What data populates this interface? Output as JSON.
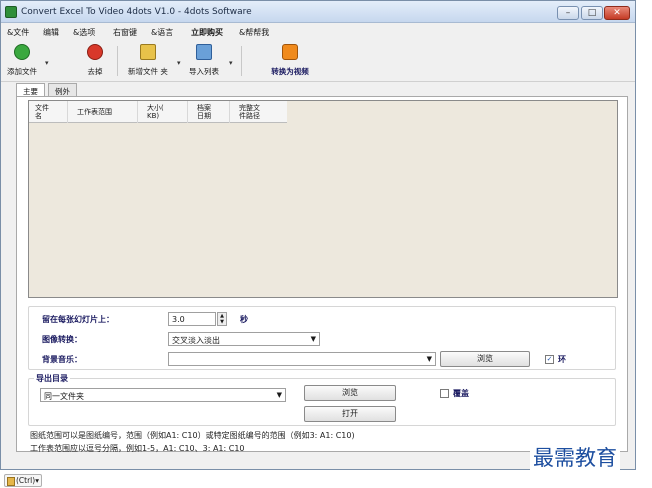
{
  "window": {
    "title": "Convert Excel To Video 4dots V1.0 - 4dots Software",
    "buttons": {
      "minimize": "–",
      "maximize": "□",
      "close": "✕"
    }
  },
  "menu": [
    {
      "label": "&文件"
    },
    {
      "label": "编辑"
    },
    {
      "label": "&选项"
    },
    {
      "label": "右窗键"
    },
    {
      "label": "&语言"
    },
    {
      "label": "立即购买"
    },
    {
      "label": "&帮帮我"
    }
  ],
  "toolbar": {
    "add_file": "添加文件",
    "remove": "去掉",
    "new_folder": "新增文件 夹",
    "import_list": "导入列表",
    "convert": "转换为视频",
    "dropdown_glyph": "▾"
  },
  "tabs": [
    {
      "label": "主要"
    },
    {
      "label": "例外"
    }
  ],
  "grid": {
    "columns": [
      "文件\n名",
      "工作表范围",
      "大小(\nKB)",
      "档案\n日期",
      "完整文\n件路径"
    ]
  },
  "options": {
    "slide_duration_label": "留在每张幻灯片上：",
    "slide_duration_value": "3.0",
    "slide_duration_unit": "秒",
    "transition_label": "图像转换：",
    "transition_value": "交叉淡入淡出",
    "music_label": "背景音乐：",
    "music_value": "",
    "browse_label": "浏览",
    "loop_label": "环"
  },
  "output": {
    "group_title": "导出目录",
    "folder_value": "同一文件夹",
    "browse_label": "浏览",
    "open_label": "打开",
    "overwrite_label": "覆盖"
  },
  "help": {
    "line1": "图纸范围可以是图纸编号，范围（例如A1: C10）或特定图纸编号的范围（例如3: A1: C10)",
    "line2": "工作表范围应以逗号分隔，例如1-5，A1: C10、3: A1: C10"
  },
  "watermark": "最需教育",
  "paste_tag": "(Ctrl)▾",
  "colors": {
    "grid_bg": "#ede8dd",
    "label_text": "#1a1a60",
    "watermark": "#1e4fa0"
  }
}
